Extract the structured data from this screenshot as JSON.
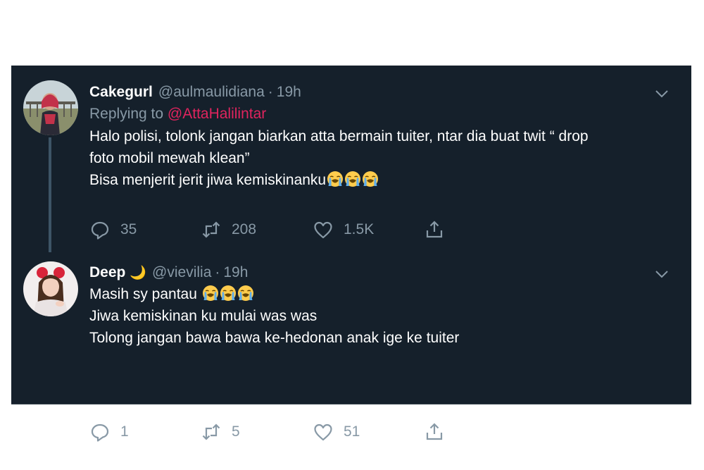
{
  "tweets": [
    {
      "name": "Cakegurl",
      "handle": "@aulmaulidiana",
      "dot": "·",
      "time": "19h",
      "replying_prefix": "Replying to ",
      "replying_to": "@AttaHalilintar",
      "lines": [
        "Halo polisi, tolonk jangan biarkan atta bermain tuiter, ntar dia buat twit “ drop",
        "foto mobil mewah klean”",
        "Bisa menjerit jerit jiwa kemiskinanku"
      ],
      "emoji": "loudly-crying-face",
      "emoji_count": 3,
      "replies": "35",
      "retweets": "208",
      "likes": "1.5K"
    },
    {
      "name": "Deep",
      "name_emoji": "🌙",
      "handle": "@vievilia",
      "dot": "·",
      "time": "19h",
      "lines": [
        "Masih sy pantau ",
        "Jiwa kemiskinan ku mulai was was",
        "Tolong jangan bawa bawa ke-hedonan anak ige ke tuiter"
      ],
      "emoji": "loudly-crying-face",
      "emoji_count": 3,
      "replies": "1",
      "retweets": "5",
      "likes": "51"
    }
  ],
  "colors": {
    "background": "#15202b",
    "text": "#ffffff",
    "secondary": "#8899a6",
    "mention": "#e0245e",
    "thread_line": "#3d5466"
  }
}
